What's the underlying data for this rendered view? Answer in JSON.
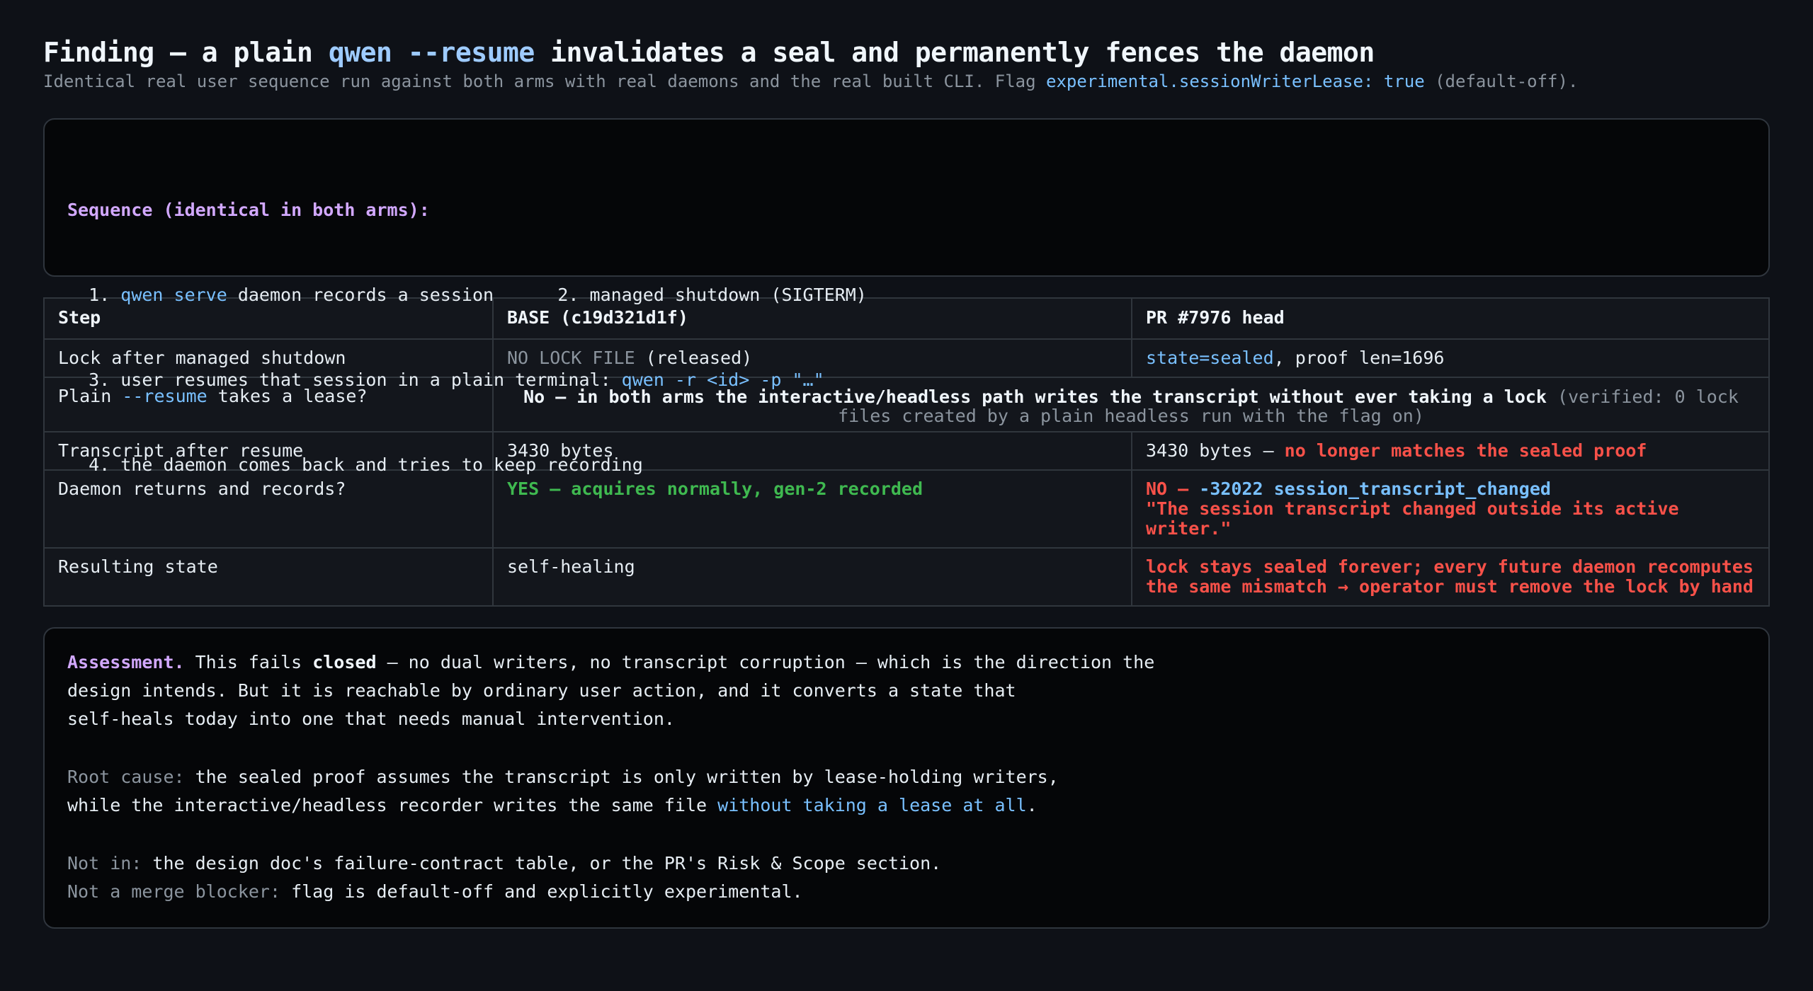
{
  "title": {
    "pre": "Finding — a plain ",
    "cmd": "qwen --resume",
    "post": " invalidates a seal and permanently fences the daemon"
  },
  "subtitle": {
    "pre": "Identical real user sequence run against both arms with real daemons and the real built CLI. Flag ",
    "flag": "experimental.sessionWriterLease: true",
    "post": " (default-off)."
  },
  "sequence": {
    "heading": "Sequence (identical in both arms):",
    "step1_num": "  1. ",
    "step1_cmd": "qwen serve",
    "step1_text": " daemon records a session      2. managed shutdown (SIGTERM)",
    "step3_text": "  3. user resumes that session in a plain terminal: ",
    "step3_cmd": "qwen -r <id> -p \"…\"",
    "step4_text": "  4. the daemon comes back and tries to keep recording"
  },
  "table": {
    "headers": [
      "Step",
      "BASE (c19d321d1f)",
      "PR #7976 head"
    ],
    "row1": {
      "step": "Lock after managed shutdown",
      "base_muted": "NO LOCK FILE",
      "base_rest": " (released)",
      "pr_state": "state=sealed",
      "pr_rest": ", proof len=1696"
    },
    "row2": {
      "step_pre": "Plain ",
      "step_cmd": "--resume",
      "step_post": " takes a lease?",
      "both_bold": "No — in both arms the interactive/headless path writes the transcript without ever taking a lock",
      "both_muted": " (verified: 0 lock files created by a plain headless run with the flag on)"
    },
    "row3": {
      "step": "Transcript after resume",
      "base": "3430 bytes",
      "pr_pre": "3430 bytes — ",
      "pr_red": "no longer matches the sealed proof"
    },
    "row4": {
      "step": "Daemon returns and records?",
      "base": "YES — acquires normally, gen-2 recorded",
      "pr_no": "NO — ",
      "pr_code": "-32022 session_transcript_changed",
      "pr_msg": "\"The session transcript changed outside its active writer.\""
    },
    "row5": {
      "step": "Resulting state",
      "base": "self-healing",
      "pr": "lock stays sealed forever; every future daemon recomputes the same mismatch → operator must remove the lock by hand"
    }
  },
  "assessment": {
    "label": "Assessment.",
    "p1a": " This fails ",
    "p1b": "closed",
    "p1c": " — no dual writers, no transcript corruption — which is the direction the",
    "p1d": "design intends. But it is reachable by ordinary user action, and it converts a state that",
    "p1e": "self-heals today into one that needs manual intervention.",
    "root_label": "Root cause:",
    "root_a": " the sealed proof assumes the transcript is only written by lease-holding writers,",
    "root_b": "while the interactive/headless recorder writes the same file ",
    "root_link": "without taking a lease at all",
    "root_c": ".",
    "notin_label": "Not in:",
    "notin_text": " the design doc's failure-contract table, or the PR's Risk & Scope section.",
    "nmb_label": "Not a merge blocker:",
    "nmb_text": " flag is default-off and explicitly experimental."
  }
}
